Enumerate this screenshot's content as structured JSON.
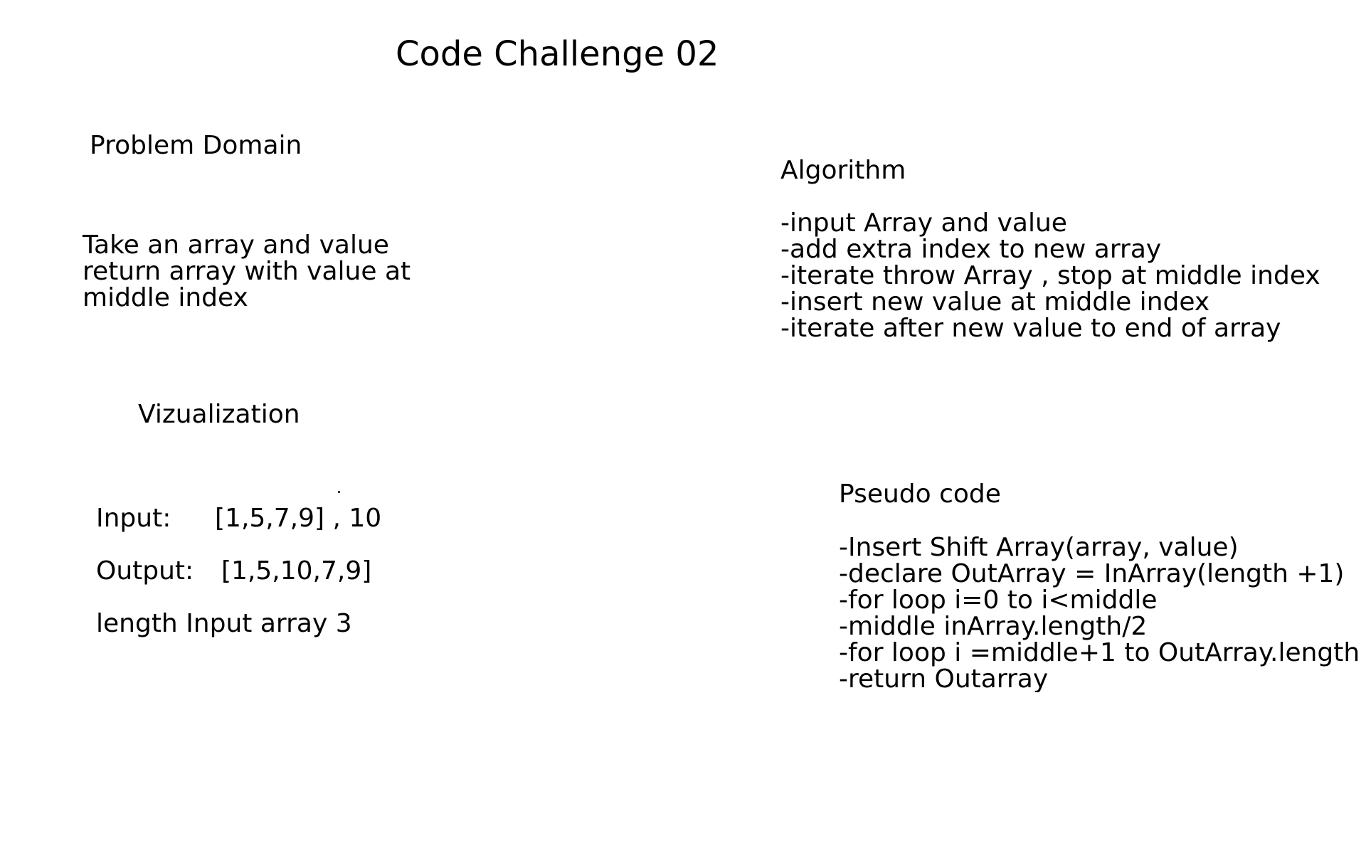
{
  "title": "Code Challenge 02",
  "problem_domain": {
    "heading": "Problem Domain",
    "lines": [
      "Take an array and value",
      "return array with value at",
      "middle index"
    ]
  },
  "algorithm": {
    "heading": "Algorithm",
    "steps": [
      "-input Array and value",
      "-add extra index to new array",
      "-iterate throw Array , stop at middle index",
      "-insert new value at middle index",
      "-iterate after new value to end of array"
    ]
  },
  "visualization": {
    "heading": "Vizualization",
    "input_label": "Input:",
    "input_value": "[1,5,7,9] , 10",
    "output_label": "Output:",
    "output_value": "[1,5,10,7,9]",
    "length_note": "length Input array 3"
  },
  "pseudo_code": {
    "heading": "Pseudo code",
    "lines": [
      "-Insert Shift Array(array, value)",
      "-declare OutArray = InArray(length +1)",
      "-for loop i=0 to i<middle",
      "-middle inArray.length/2",
      "-for loop i =middle+1 to OutArray.length",
      "-return Outarray"
    ]
  }
}
